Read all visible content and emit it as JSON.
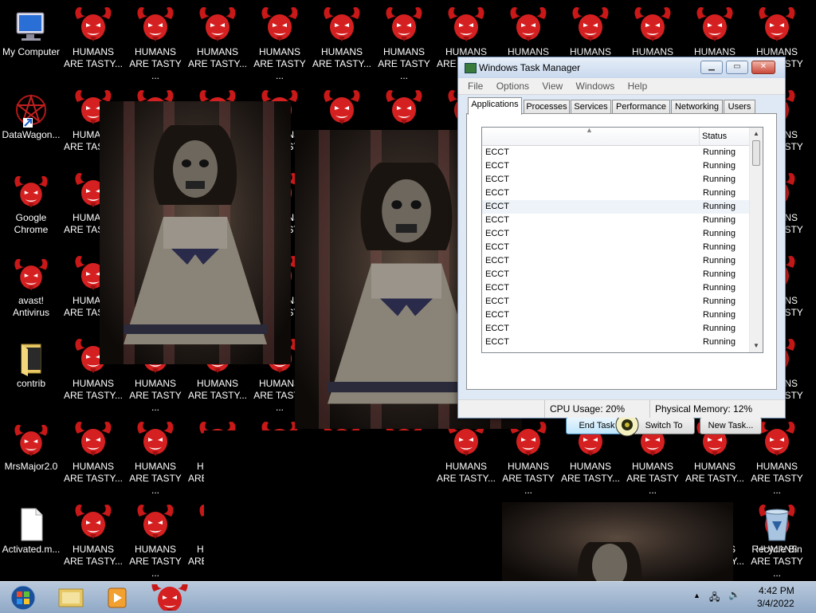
{
  "desktop": {
    "icons": [
      {
        "label": "My Computer",
        "icon": "computer-icon"
      },
      {
        "label": "DataWagon...",
        "icon": "pentagram-icon"
      },
      {
        "label": "Google\nChrome",
        "icon": "devil-icon"
      },
      {
        "label": "avast!\nAntivirus",
        "icon": "devil-icon"
      },
      {
        "label": "contrib",
        "icon": "folder-icon"
      },
      {
        "label": "MrsMajor2.0",
        "icon": "devil-icon"
      },
      {
        "label": "Activated.m...",
        "icon": "document-icon"
      }
    ],
    "devil_labels": [
      "HUMANS\nARE TASTY...",
      "HUMANS\nARE TASTY ..."
    ],
    "recycle_bin_label": "Recycle Bin"
  },
  "task_manager": {
    "title": "Windows Task Manager",
    "menu": [
      "File",
      "Options",
      "View",
      "Windows",
      "Help"
    ],
    "tabs": [
      "Applications",
      "Processes",
      "Services",
      "Performance",
      "Networking",
      "Users"
    ],
    "active_tab": "Applications",
    "columns": {
      "task": "",
      "status": "Status"
    },
    "rows": [
      {
        "task": "ECCT",
        "status": "Running"
      },
      {
        "task": "ECCT",
        "status": "Running"
      },
      {
        "task": "ECCT",
        "status": "Running"
      },
      {
        "task": "ECCT",
        "status": "Running"
      },
      {
        "task": "ECCT",
        "status": "Running"
      },
      {
        "task": "ECCT",
        "status": "Running"
      },
      {
        "task": "ECCT",
        "status": "Running"
      },
      {
        "task": "ECCT",
        "status": "Running"
      },
      {
        "task": "ECCT",
        "status": "Running"
      },
      {
        "task": "ECCT",
        "status": "Running"
      },
      {
        "task": "ECCT",
        "status": "Running"
      },
      {
        "task": "ECCT",
        "status": "Running"
      },
      {
        "task": "ECCT",
        "status": "Running"
      },
      {
        "task": "ECCT",
        "status": "Running"
      },
      {
        "task": "ECCT",
        "status": "Running"
      }
    ],
    "buttons": {
      "end_task": "End Task",
      "switch_to": "Switch To",
      "new_task": "New Task..."
    },
    "status": {
      "processes": "",
      "cpu": "CPU Usage: 20%",
      "memory": "Physical Memory: 12%"
    }
  },
  "taskbar": {
    "items": [
      "start-orb-icon",
      "explorer-folder-icon",
      "media-player-icon",
      "devil-icon"
    ],
    "time": "4:42 PM",
    "date": "3/4/2022"
  },
  "colors": {
    "devil_red": "#d42020",
    "taskbar": "#a9bdd6",
    "tm_frame": "#dfe9f5"
  }
}
